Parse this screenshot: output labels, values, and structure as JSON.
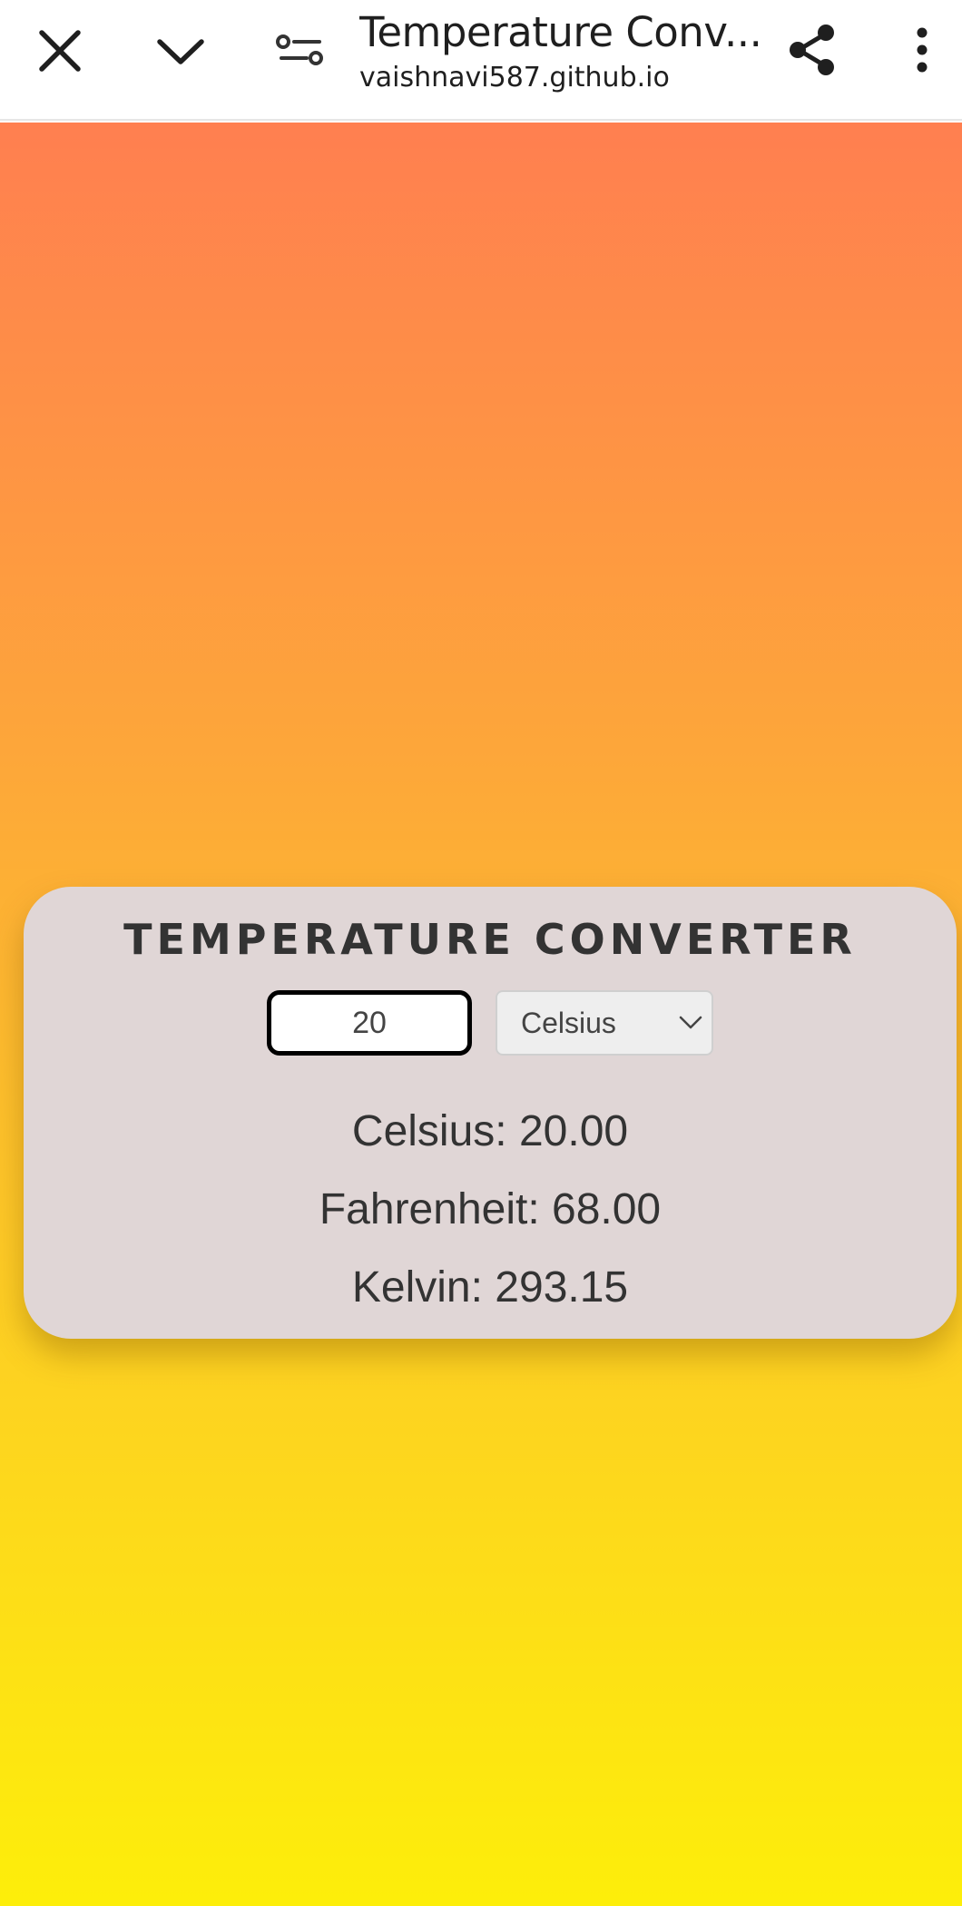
{
  "browser": {
    "title": "Temperature Conv...",
    "url": "vaishnavi587.github.io",
    "icons": [
      "close-icon",
      "chevron-down-icon",
      "page-settings-icon",
      "share-icon",
      "more-vert-icon"
    ]
  },
  "app": {
    "heading": "TEMPERATURE CONVERTER",
    "input_value": "20",
    "unit_selected": "Celsius",
    "results": {
      "celsius": "Celsius: 20.00",
      "fahrenheit": "Fahrenheit: 68.00",
      "kelvin": "Kelvin: 293.15"
    }
  },
  "colors": {
    "gradient_top": "#ff7f50",
    "gradient_bottom": "#fdee0a",
    "card_bg": "#e0d6d6",
    "text": "#333333"
  }
}
